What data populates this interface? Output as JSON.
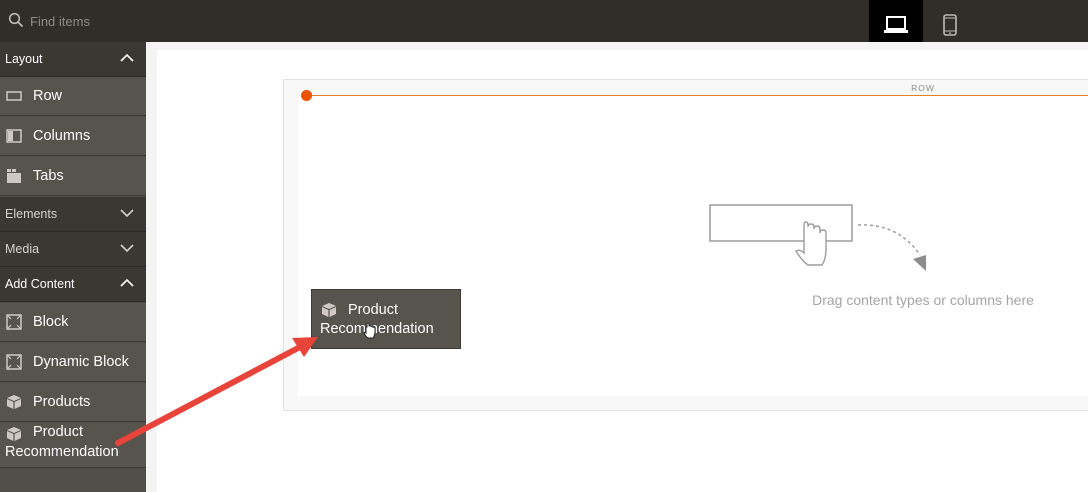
{
  "search": {
    "placeholder": "Find items"
  },
  "devices": {
    "desktop_icon": "laptop-icon",
    "mobile_icon": "mobile-icon"
  },
  "sidebar": {
    "layout": {
      "label": "Layout",
      "state": "expanded"
    },
    "layout_items": [
      {
        "label": "Row",
        "icon": "row-icon"
      },
      {
        "label": "Columns",
        "icon": "columns-icon"
      },
      {
        "label": "Tabs",
        "icon": "tabs-icon"
      }
    ],
    "elements": {
      "label": "Elements",
      "state": "collapsed"
    },
    "media": {
      "label": "Media",
      "state": "collapsed"
    },
    "add_content": {
      "label": "Add Content",
      "state": "expanded"
    },
    "add_content_items": [
      {
        "label": "Block",
        "icon": "block-icon"
      },
      {
        "label": "Dynamic Block",
        "icon": "dynamic-block-icon"
      },
      {
        "label": "Products",
        "icon": "products-icon"
      },
      {
        "label_line1": "Product",
        "label_line2": "Recommendation",
        "icon": "product-recommendation-icon"
      }
    ]
  },
  "stage": {
    "row_label": "ROW",
    "drop_hint": "Drag content types or columns here"
  },
  "ghost": {
    "label_line1": "Product",
    "label_line2": "Recommendation"
  },
  "colors": {
    "topbar": "#312e2a",
    "sidebar": "#514d48",
    "accent": "#eb5202",
    "arrow": "#e8443a"
  }
}
